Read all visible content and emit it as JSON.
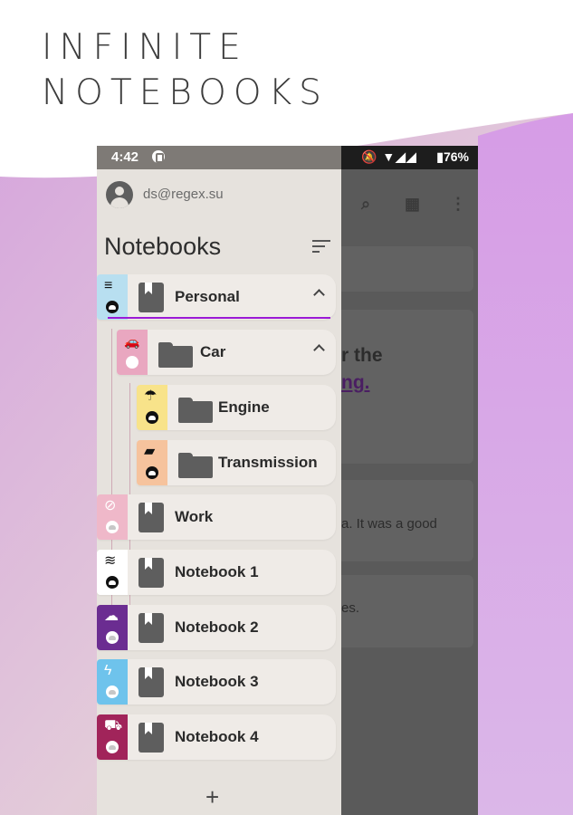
{
  "promo": {
    "line1": "INFINITE",
    "line2": "NOTEBOOKS"
  },
  "status_bar": {
    "time": "4:42",
    "right_icons": "🔕 ▼◢◢",
    "battery": "▮76%"
  },
  "drawer": {
    "account_email": "ds@regex.su",
    "title": "Notebooks",
    "add_label": "+",
    "items": [
      {
        "label": "Personal",
        "kind": "notebook",
        "color": "#b8dff0",
        "glyph": "≡"
      },
      {
        "label": "Car",
        "kind": "folder",
        "color": "#e9a7c0",
        "glyph": "🚗"
      },
      {
        "label": "Engine",
        "kind": "folder",
        "color": "#f8e38a",
        "glyph": "☂"
      },
      {
        "label": "Transmission",
        "kind": "folder",
        "color": "#f6c39d",
        "glyph": "▰"
      },
      {
        "label": "Work",
        "kind": "notebook",
        "color": "#efb8c9",
        "glyph": "⊘"
      },
      {
        "label": "Notebook 1",
        "kind": "notebook",
        "color": "#ffffff",
        "glyph": "≋"
      },
      {
        "label": "Notebook 2",
        "kind": "notebook",
        "color": "#6b2d91",
        "glyph": "☁"
      },
      {
        "label": "Notebook 3",
        "kind": "notebook",
        "color": "#6ec3ec",
        "glyph": "ϟ"
      },
      {
        "label": "Notebook 4",
        "kind": "notebook",
        "color": "#a1245a",
        "glyph": "⛟"
      }
    ]
  },
  "main_content": {
    "heading_fragment": "r the",
    "link_fragment": "ng.",
    "text_fragment_1": "a. It was a good",
    "text_fragment_2": "es."
  },
  "colors": {
    "accent": "#9b19d6",
    "drawer_bg": "#e6e2dd",
    "scrim": "#545454"
  }
}
